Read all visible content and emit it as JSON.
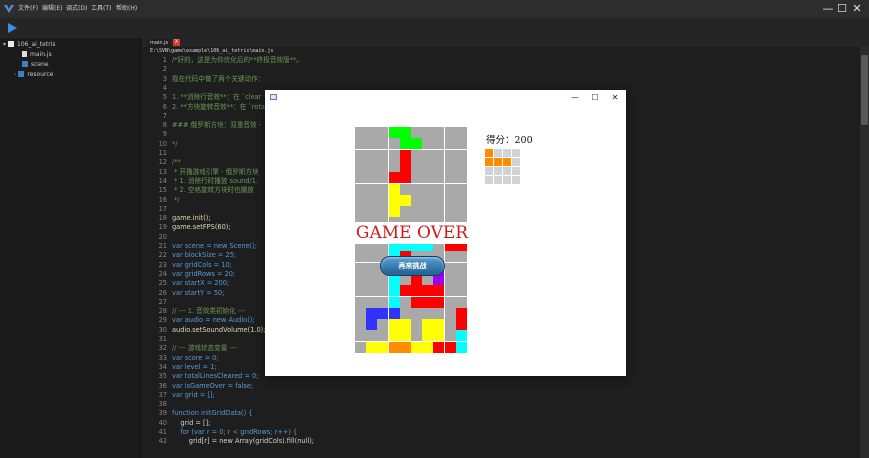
{
  "menu": [
    "文件(F)",
    "编辑(E)",
    "调式(D)",
    "工具(T)",
    "帮助(H)"
  ],
  "window_controls": {
    "minimize": "—",
    "maximize": "☐",
    "close": "✕"
  },
  "sidebar": {
    "project": "106_ai_tetris",
    "items": [
      "main.js",
      "scene",
      "resource"
    ]
  },
  "editor": {
    "tab": "main.js",
    "tab_close": "X",
    "path": "E:\\SVN\\game\\example\\106_ai_tetris\\main.js",
    "lines": [
      [
        1,
        "/*好的，这是为你优化后的**终极音效版**。",
        "cm"
      ],
      [
        2,
        "",
        ""
      ],
      [
        3,
        "我在代码中做了两个关键动作：",
        "cm"
      ],
      [
        4,
        "",
        ""
      ],
      [
        5,
        "1. **消除行音效**：在 `clear",
        "cm"
      ],
      [
        6,
        "2. **方块旋转音效**：在 `rota",
        "cm"
      ],
      [
        7,
        "",
        ""
      ],
      [
        8,
        "### 俄罗斯方块：双重音效 -",
        "cm"
      ],
      [
        9,
        "",
        ""
      ],
      [
        10,
        "*/",
        "cm"
      ],
      [
        11,
        "",
        ""
      ],
      [
        12,
        "/**",
        "cm"
      ],
      [
        13,
        " * 开撸游戏引擎 - 俄罗斯方块",
        "cm"
      ],
      [
        14,
        " * 1. 消除行时播放 sound/1.",
        "cm"
      ],
      [
        15,
        " * 2. 空格旋转方块时也播放",
        "cm"
      ],
      [
        16,
        " */",
        "cm"
      ],
      [
        17,
        "",
        ""
      ],
      [
        18,
        "game.init();",
        "fn"
      ],
      [
        19,
        "game.setFPS(60);",
        "fn"
      ],
      [
        20,
        "",
        ""
      ],
      [
        21,
        "var scene = new Scene();",
        "kw"
      ],
      [
        22,
        "var blockSize = 25;",
        "kw"
      ],
      [
        23,
        "var gridCols = 10;",
        "kw"
      ],
      [
        24,
        "var gridRows = 20;",
        "kw"
      ],
      [
        25,
        "var startX = 200;",
        "kw"
      ],
      [
        26,
        "var startY = 50;",
        "kw"
      ],
      [
        27,
        "",
        ""
      ],
      [
        28,
        "// --- 1. 音效类初始化 ---",
        "cm"
      ],
      [
        29,
        "var audio = new Audio();",
        "kw"
      ],
      [
        30,
        "audio.setSoundVolume(1.0);",
        "fn"
      ],
      [
        31,
        "",
        ""
      ],
      [
        32,
        "// --- 游戏状态变量 ---",
        "cm"
      ],
      [
        33,
        "var score = 0;",
        "kw"
      ],
      [
        34,
        "var level = 1;",
        "kw"
      ],
      [
        35,
        "var totalLinesCleared = 0;",
        "kw"
      ],
      [
        36,
        "var isGameOver = false;",
        "kw"
      ],
      [
        37,
        "var grid = [];",
        "kw"
      ],
      [
        38,
        "",
        ""
      ],
      [
        39,
        "function initGridData() {",
        "kw"
      ],
      [
        40,
        "    grid = [];",
        ""
      ],
      [
        41,
        "    for (var r = 0; r < gridRows; r++) {",
        "kw"
      ],
      [
        42,
        "        grid[r] = new Array(gridCols).fill(null);",
        ""
      ]
    ]
  },
  "game": {
    "score_label": "得分：200",
    "game_over": "GAME  OVER",
    "retry_button": "再來挑战",
    "colors": {
      "empty": "#a9a9a9",
      "grid": "#ffffff",
      "green": "#00ff00",
      "red": "#ff0000",
      "yellow": "#ffff00",
      "cyan": "#00ffff",
      "blue": "#3232ff",
      "purple": "#a000f0",
      "orange": "#ff8c00",
      "preview_empty": "#d3d3d3"
    },
    "board": [
      "...GG.....",
      "....GG....",
      "....R.....",
      "....R.....",
      "...RR.....",
      "...Y......",
      "...YY.....",
      "...Y......",
      "..........",
      "..........",
      "...CCCC.RR",
      "...CR.....",
      "...CRRPP..",
      "...C.R.P..",
      "...CRRRR..",
      "...C.RRR..",
      ".BBB.....R",
      ".B.YY.YY.R",
      "...YY.YY.C",
      ".YYOOYYRRC"
    ],
    "next_piece": [
      "O...",
      "OOO.",
      "....",
      "...."
    ]
  }
}
